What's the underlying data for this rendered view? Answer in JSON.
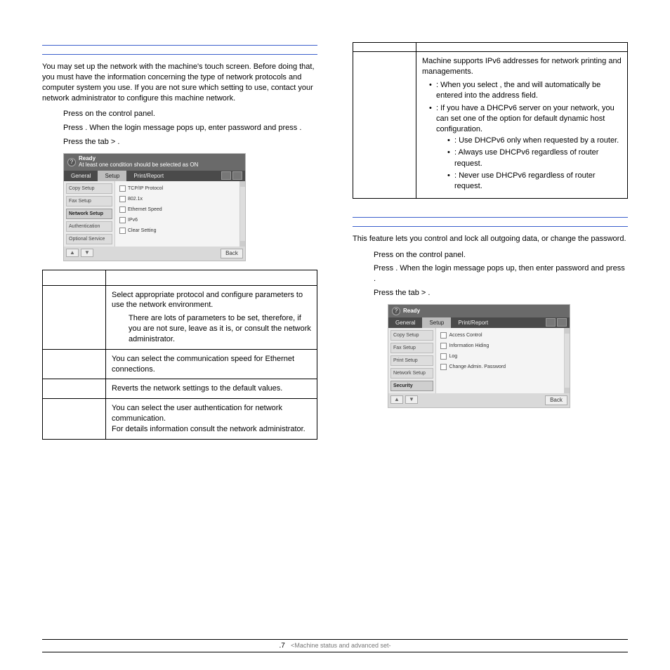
{
  "left": {
    "intro": "You may set up the network with the machine's touch screen. Before doing that, you must have the information concerning the type of network protocols and computer system you use. If you are not sure which setting to use, contact your network administrator to configure this machine network.",
    "steps": {
      "s1a": "Press ",
      "s1b": " on the control panel.",
      "s2a": "Press ",
      "s2b": " . When the login message pops up, enter password and press ",
      "s2c": " .",
      "s3a": "Press the ",
      "s3b": " tab > ",
      "s3c": " ."
    },
    "panel1": {
      "ready": "Ready",
      "sub": "At least one condition should be selected as ON",
      "tabs": {
        "general": "General",
        "setup": "Setup",
        "print": "Print/Report"
      },
      "left_buttons": [
        "Copy Setup",
        "Fax Setup",
        "Network Setup",
        "Authentication",
        "Optional Service"
      ],
      "opts": {
        "tcpip": "TCP/IP Protocol",
        "dot1x": "802.1x",
        "eth": "Ethernet Speed",
        "ipv6": "IPv6",
        "clr": "Clear Setting"
      },
      "back": "Back"
    },
    "table": {
      "rows": [
        {
          "k": "",
          "v": "Select appropriate protocol and configure parameters to use the network environment.",
          "note": "There are lots of parameters to be set, therefore, if you are not sure, leave as it is, or consult the network administrator."
        },
        {
          "k": "",
          "v": "You can select the communication speed for Ethernet connections."
        },
        {
          "k": "",
          "v": "Reverts the network settings to the default values."
        },
        {
          "k": "",
          "v": "You can select the user authentication for network communication.\nFor details information consult the network administrator."
        }
      ]
    }
  },
  "right": {
    "ipv6": {
      "intro": "Machine supports IPv6 addresses for network printing and managements.",
      "b1a": ": When you select ",
      "b1b": ", the ",
      "b1c": " and ",
      "b1d": " will automatically be entered into the address field.",
      "b2": ": If you have a DHCPv6 server on your network, you can set one of the option for default dynamic host configuration.",
      "s1": ": Use DHCPv6 only when requested by a router.",
      "s2": ": Always use DHCPv6 regardless of router request.",
      "s3": ": Never use DHCPv6 regardless of router request."
    },
    "sec_intro": "This feature lets you control and lock all outgoing data, or change the password.",
    "steps": {
      "s1a": "Press ",
      "s1b": " on the control panel.",
      "s2a": "Press ",
      "s2b": " . When the login message pops up, then enter password and press ",
      "s2c": " .",
      "s3a": "Press the ",
      "s3b": " tab > ",
      "s3c": " ."
    },
    "panel2": {
      "ready": "Ready",
      "tabs": {
        "general": "General",
        "setup": "Setup",
        "print": "Print/Report"
      },
      "left_buttons": [
        "Copy Setup",
        "Fax Setup",
        "Print Setup",
        "Network Setup",
        "Security"
      ],
      "opts": {
        "ac": "Access Control",
        "ih": "Information Hiding",
        "log": "Log",
        "cap": "Change Admin. Password"
      },
      "back": "Back"
    }
  },
  "footer": {
    "page": ".7",
    "chapter": "<Machine status and advanced set-"
  }
}
